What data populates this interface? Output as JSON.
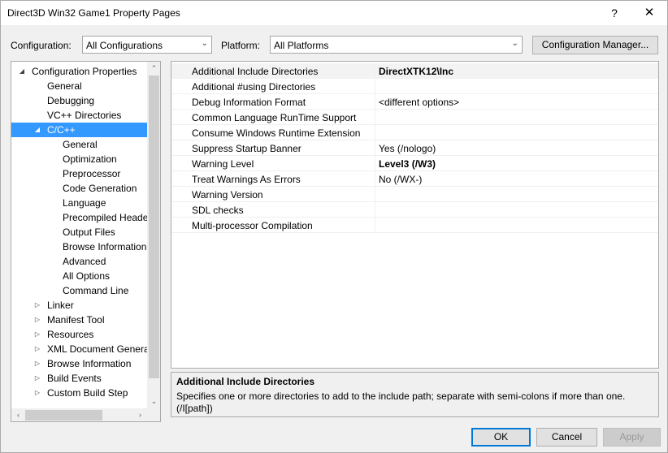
{
  "window": {
    "title": "Direct3D Win32 Game1 Property Pages",
    "help": "?",
    "close": "✕"
  },
  "config": {
    "configuration_label": "Configuration:",
    "configuration_value": "All Configurations",
    "platform_label": "Platform:",
    "platform_value": "All Platforms",
    "manager_button": "Configuration Manager..."
  },
  "tree": [
    {
      "label": "Configuration Properties",
      "toggle": "◢",
      "level": 0
    },
    {
      "label": "General",
      "toggle": "",
      "level": 1
    },
    {
      "label": "Debugging",
      "toggle": "",
      "level": 1
    },
    {
      "label": "VC++ Directories",
      "toggle": "",
      "level": 1
    },
    {
      "label": "C/C++",
      "toggle": "◢",
      "level": 1,
      "selected": true
    },
    {
      "label": "General",
      "toggle": "",
      "level": 2
    },
    {
      "label": "Optimization",
      "toggle": "",
      "level": 2
    },
    {
      "label": "Preprocessor",
      "toggle": "",
      "level": 2
    },
    {
      "label": "Code Generation",
      "toggle": "",
      "level": 2
    },
    {
      "label": "Language",
      "toggle": "",
      "level": 2
    },
    {
      "label": "Precompiled Heade",
      "toggle": "",
      "level": 2
    },
    {
      "label": "Output Files",
      "toggle": "",
      "level": 2
    },
    {
      "label": "Browse Information",
      "toggle": "",
      "level": 2
    },
    {
      "label": "Advanced",
      "toggle": "",
      "level": 2
    },
    {
      "label": "All Options",
      "toggle": "",
      "level": 2
    },
    {
      "label": "Command Line",
      "toggle": "",
      "level": 2
    },
    {
      "label": "Linker",
      "toggle": "▷",
      "level": 1
    },
    {
      "label": "Manifest Tool",
      "toggle": "▷",
      "level": 1
    },
    {
      "label": "Resources",
      "toggle": "▷",
      "level": 1
    },
    {
      "label": "XML Document Genera",
      "toggle": "▷",
      "level": 1
    },
    {
      "label": "Browse Information",
      "toggle": "▷",
      "level": 1
    },
    {
      "label": "Build Events",
      "toggle": "▷",
      "level": 1
    },
    {
      "label": "Custom Build Step",
      "toggle": "▷",
      "level": 1
    }
  ],
  "tree_scroll": {
    "up": "⌃",
    "down": "⌄",
    "left": "‹",
    "right": "›"
  },
  "properties": [
    {
      "name": "Additional Include Directories",
      "value": "DirectXTK12\\Inc",
      "bold": true,
      "selected": true
    },
    {
      "name": "Additional #using Directories",
      "value": "",
      "bold": false
    },
    {
      "name": "Debug Information Format",
      "value": "<different options>",
      "bold": false
    },
    {
      "name": "Common Language RunTime Support",
      "value": "",
      "bold": false
    },
    {
      "name": "Consume Windows Runtime Extension",
      "value": "",
      "bold": false
    },
    {
      "name": "Suppress Startup Banner",
      "value": "Yes (/nologo)",
      "bold": false
    },
    {
      "name": "Warning Level",
      "value": "Level3 (/W3)",
      "bold": true
    },
    {
      "name": "Treat Warnings As Errors",
      "value": "No (/WX-)",
      "bold": false
    },
    {
      "name": "Warning Version",
      "value": "",
      "bold": false
    },
    {
      "name": "SDL checks",
      "value": "",
      "bold": false
    },
    {
      "name": "Multi-processor Compilation",
      "value": "",
      "bold": false
    }
  ],
  "description": {
    "title": "Additional Include Directories",
    "text": "Specifies one or more directories to add to the include path; separate with semi-colons if more than one. (/I[path])"
  },
  "buttons": {
    "ok": "OK",
    "cancel": "Cancel",
    "apply": "Apply"
  },
  "colors": {
    "selection": "#3399ff",
    "focus_border": "#0078d7"
  }
}
